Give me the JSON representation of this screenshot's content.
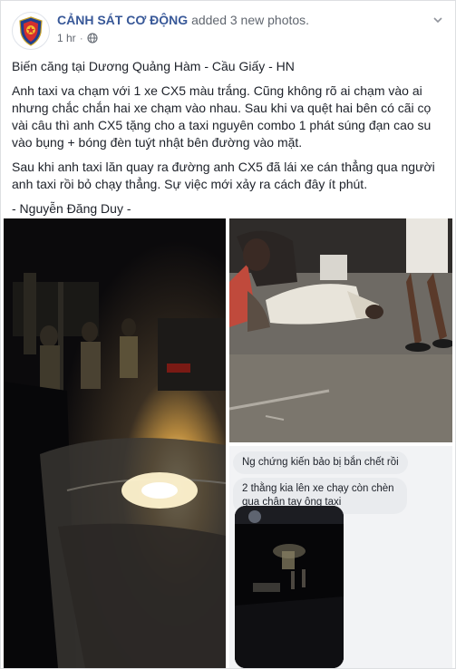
{
  "header": {
    "page_name": "CẢNH SÁT CƠ ĐỘNG",
    "action_text": "added 3 new photos.",
    "timestamp": "1 hr",
    "separator": "·",
    "privacy_icon": "globe-icon",
    "menu_icon": "chevron-down-icon",
    "avatar_icon": "police-shield-logo"
  },
  "post": {
    "paragraphs": [
      "Biến căng tại Dương Quảng Hàm - Cầu Giấy - HN",
      "Anh taxi va chạm với 1 xe CX5 màu trắng. Cũng không rõ ai chạm vào ai nhưng chắc chắn hai xe chạm vào nhau. Sau khi va quệt hai bên có cãi cọ vài câu thì anh CX5 tặng cho a taxi nguyên combo 1 phát súng đạn cao su vào bụng + bóng đèn tuýt nhật bên đường vào mặt.",
      "Sau khi anh taxi lăn quay ra đường anh CX5 đã lái xe cán thẳng qua người anh taxi rồi bỏ chạy thẳng. Sự việc mới xảy ra cách đây ít phút.",
      "- Nguyễn Đăng Duy -"
    ]
  },
  "photos": {
    "chat_messages": [
      "Ng chứng kiến bảo bị bắn chết rồi",
      "2 thằng kia lên xe chạy còn chèn qua chân tay ông taxi"
    ]
  },
  "colors": {
    "link": "#385898",
    "meta": "#616770",
    "text": "#1d2129",
    "border": "#dddfe2",
    "bubble": "#e9ebee"
  }
}
